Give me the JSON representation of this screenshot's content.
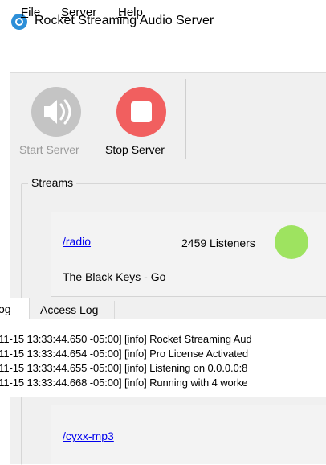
{
  "window": {
    "title": "Rocket Streaming Audio Server",
    "icon": "rocket-app-icon"
  },
  "menu": [
    {
      "mnemonic": "F",
      "rest": "ile"
    },
    {
      "mnemonic": "S",
      "rest": "erver"
    },
    {
      "mnemonic": "H",
      "rest": "elp"
    }
  ],
  "toolbar": {
    "start_label": "Start Server",
    "start_icon": "speaker-broadcast-icon",
    "stop_label": "Stop Server",
    "stop_icon": "stop-icon"
  },
  "streams": {
    "title": "Streams",
    "items": [
      {
        "mount": "/radio",
        "listeners": "2459 Listeners",
        "now_playing": "The Black Keys - Go",
        "status_color": "#9ee360"
      },
      {
        "mount": "/cyxx-mp3"
      }
    ]
  },
  "log_panel": {
    "tabs": [
      "og",
      "Access Log"
    ],
    "lines": [
      "-11-15 13:33:44.650 -05:00] [info] Rocket Streaming Aud",
      "-11-15 13:33:44.654 -05:00] [info] Pro License Activated",
      "-11-15 13:33:44.655 -05:00] [info] Listening on 0.0.0.0:8",
      "-11-15 13:33:44.668 -05:00] [info] Running with 4 worke"
    ]
  },
  "colors": {
    "stop": "#f15f5f",
    "start_disabled": "#c4c4c4",
    "link": "#0000ee",
    "status_live": "#9ee360"
  }
}
